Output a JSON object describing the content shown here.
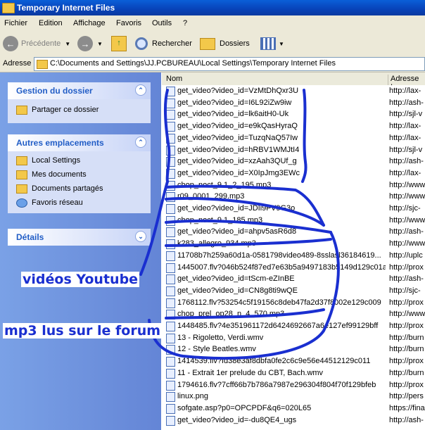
{
  "window": {
    "title": "Temporary Internet Files"
  },
  "menu": [
    "Fichier",
    "Edition",
    "Affichage",
    "Favoris",
    "Outils",
    "?"
  ],
  "toolbar": {
    "back": "Précédente",
    "search": "Rechercher",
    "folders": "Dossiers"
  },
  "address": {
    "label": "Adresse",
    "path": "C:\\Documents and Settings\\JJ.PCBUREAU\\Local Settings\\Temporary Internet Files"
  },
  "panels": {
    "gestion": {
      "title": "Gestion du dossier",
      "items": [
        "Partager ce dossier"
      ]
    },
    "autres": {
      "title": "Autres emplacements",
      "items": [
        "Local Settings",
        "Mes documents",
        "Documents partagés",
        "Favoris réseau"
      ]
    },
    "details": {
      "title": "Détails"
    }
  },
  "columns": {
    "name": "Nom",
    "address": "Adresse Ir"
  },
  "files": [
    {
      "name": "get_video?video_id=VzMtDhQxr3U",
      "addr": "http://lax-"
    },
    {
      "name": "get_video?video_id=I6L92iZw9iw",
      "addr": "http://ash-"
    },
    {
      "name": "get_video?video_id=lk6aitH0-Uk",
      "addr": "http://sjl-v"
    },
    {
      "name": "get_video?video_id=e9kQasHyraQ",
      "addr": "http://lax-"
    },
    {
      "name": "get_video?video_id=TuzqNaQ57Iw",
      "addr": "http://lax-"
    },
    {
      "name": "get_video?video_id=hRBV1WMJtI4",
      "addr": "http://sjl-v"
    },
    {
      "name": "get_video?video_id=xzAah3QUf_g",
      "addr": "http://ash-"
    },
    {
      "name": "get_video?video_id=X0IpJmg3EWc",
      "addr": "http://lax-"
    },
    {
      "name": "chop_noct_9.1_2_195.mp3",
      "addr": "http://www"
    },
    {
      "name": "r09_0001_299.mp3",
      "addr": "http://www"
    },
    {
      "name": "get_video?video_id=JDIi9FV9G3o",
      "addr": "http://sjc-"
    },
    {
      "name": "chop_noct_9.1_185.mp3",
      "addr": "http://www"
    },
    {
      "name": "get_video?video_id=ahpv5asR6d8",
      "addr": "http://ash-"
    },
    {
      "name": "k283_allegro_934.mp3",
      "addr": "http://www"
    },
    {
      "name": "11708b7h259a60d1a-0581798video489-8sslasl36184619...",
      "addr": "http://uplc"
    },
    {
      "name": "1445007.flv?046b524f87ed7e63b5a9497183b5149d129c01a",
      "addr": "http://prox"
    },
    {
      "name": "get_video?video_id=tScm-eZInBE",
      "addr": "http://ash-"
    },
    {
      "name": "get_video?video_id=CN8g8ti9wQE",
      "addr": "http://sjc-"
    },
    {
      "name": "1768112.flv?53254c5f19156c8deb47fa2d37f8002e129c009",
      "addr": "http://prox"
    },
    {
      "name": "chop_prel_op28_n_4_570.mp3",
      "addr": "http://www"
    },
    {
      "name": "1448485.flv?4e351961172d6424692667a6e127ef99129bff",
      "addr": "http://prox"
    },
    {
      "name": "13 - Rigoletto, Verdi.wmv",
      "addr": "http://burn"
    },
    {
      "name": "12 - Style Beatles.wmv",
      "addr": "http://burn"
    },
    {
      "name": "1414539.flv?fd38e3af8dbfa0fe2c6c9e56e44512129c011",
      "addr": "http://prox"
    },
    {
      "name": "11 - Extrait 1er prelude du CBT, Bach.wmv",
      "addr": "http://burn"
    },
    {
      "name": "1794616.flv?7cff66b7b786a7987e296304f804f70f129bfeb",
      "addr": "http://prox"
    },
    {
      "name": "linux.png",
      "addr": "http://pers"
    },
    {
      "name": "sofgate.asp?p0=OPCPDF&q6=020L65",
      "addr": "https://fina"
    },
    {
      "name": "get_video?video_id=-du8QE4_ugs",
      "addr": "http://ash-"
    }
  ],
  "annotations": {
    "videos": "vidéos Youtube",
    "mp3": "mp3 lus sur le forum",
    "color": "#1a2fd0"
  }
}
